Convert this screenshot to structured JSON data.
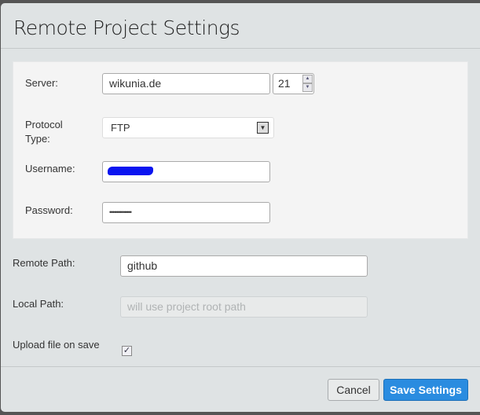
{
  "dialog": {
    "title": "Remote Project Settings"
  },
  "server": {
    "label": "Server:",
    "value": "wikunia.de",
    "port": "21"
  },
  "protocol": {
    "label_line1": "Protocol",
    "label_line2": "Type:",
    "value": "FTP"
  },
  "username": {
    "label": "Username:",
    "value_redacted": true
  },
  "password": {
    "label": "Password:",
    "masked_value": "•••••••••••••"
  },
  "remote_path": {
    "label": "Remote Path:",
    "value": "github"
  },
  "local_path": {
    "label": "Local Path:",
    "placeholder": "will use project root path"
  },
  "upload_on_save": {
    "label": "Upload file on save",
    "checked": true
  },
  "buttons": {
    "cancel": "Cancel",
    "save": "Save Settings"
  },
  "colors": {
    "accent": "#2a8ce0"
  }
}
